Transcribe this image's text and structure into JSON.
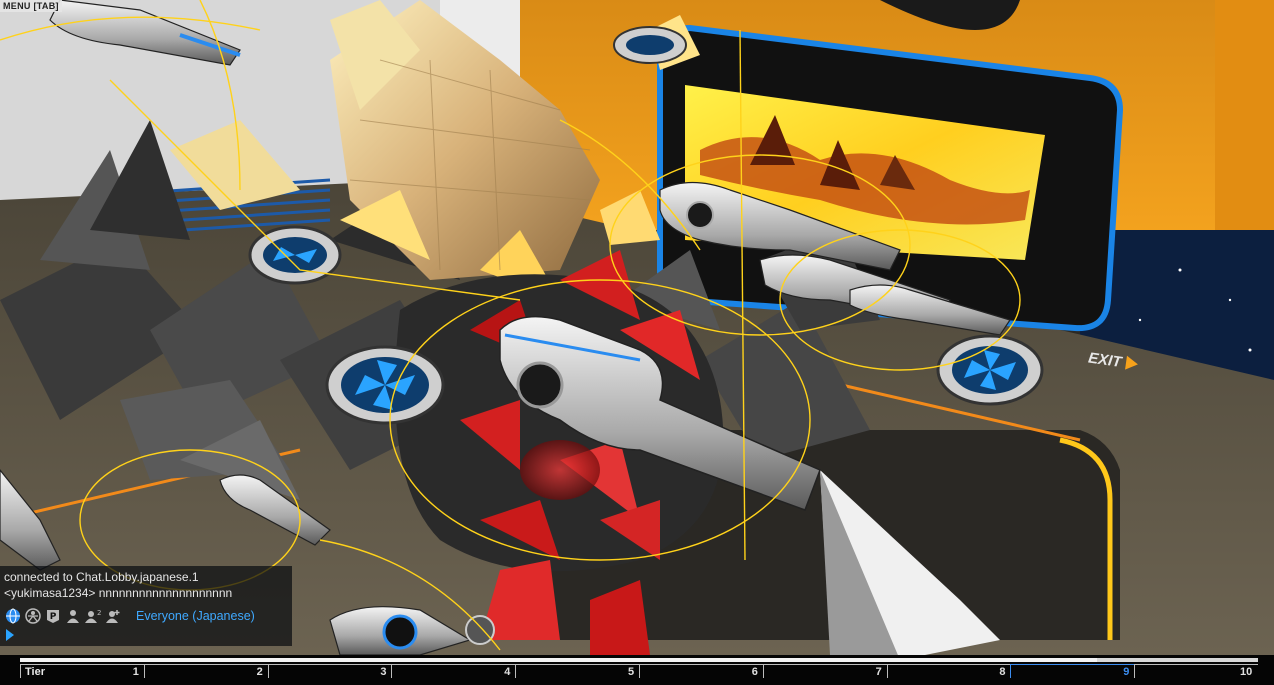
{
  "hud": {
    "menu_label": "MENU [TAB]",
    "exit_label": "EXIT"
  },
  "chat": {
    "lines": [
      "connected to Chat.Lobby.japanese.1",
      "<yukimasa1234> nnnnnnnnnnnnnnnnnnnn"
    ],
    "channel": "Everyone (Japanese)",
    "icons": [
      "globe-icon",
      "person-circle-icon",
      "party-p-icon",
      "single-user-icon",
      "two-users-icon",
      "user-plus-icon"
    ]
  },
  "tier_bar": {
    "label": "Tier",
    "tiers": [
      "1",
      "2",
      "3",
      "4",
      "5",
      "6",
      "7",
      "8",
      "9",
      "10"
    ],
    "active_tier": "9",
    "progress_fraction": 0.87
  },
  "colors": {
    "chat_channel": "#3fa9ff",
    "tier_active": "#3b8df0",
    "exit_arrow": "#f7a21b",
    "hud_lines": "#ffd21a"
  }
}
